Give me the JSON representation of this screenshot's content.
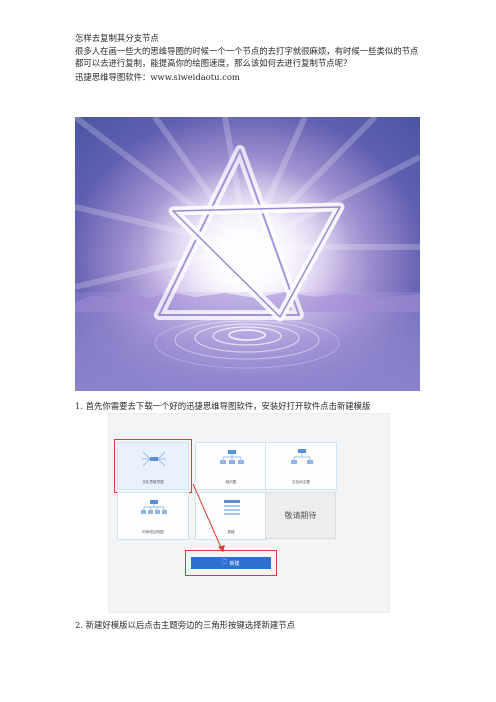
{
  "title": "怎样去复制其分支节点",
  "intro": "很多人在画一些大的思维导图的时候一个一个节点的去打字就很麻烦，有时候一些类似的节点都可以去进行复制，能提高你的绘图速度，那么该如何去进行复制节点呢？",
  "software_line": "迅捷思维导图软件：www.siweidaotu.com",
  "step1": {
    "number": "1.",
    "text": "首先你需要去下载一个好的迅捷思维导图软件，安装好打开软件点击新建模版"
  },
  "step2": {
    "number": "2.",
    "text": "新建好模版以后点击主题旁边的三角形按键选择新建节点"
  },
  "templates": [
    {
      "label": "文化思维导图",
      "icon": "mindmap-icon"
    },
    {
      "label": "组织图",
      "icon": "org-chart-icon"
    },
    {
      "label": "文化树主题",
      "icon": "tree-icon"
    },
    {
      "label": "时间线结构图",
      "icon": "timeline-icon"
    },
    {
      "label": "表格",
      "icon": "list-icon"
    }
  ],
  "coming_soon": "敬请期待",
  "new_button": "新建",
  "colors": {
    "highlight": "#e53935",
    "button": "#2f6fd0",
    "tile_border": "#cfe3f7"
  }
}
